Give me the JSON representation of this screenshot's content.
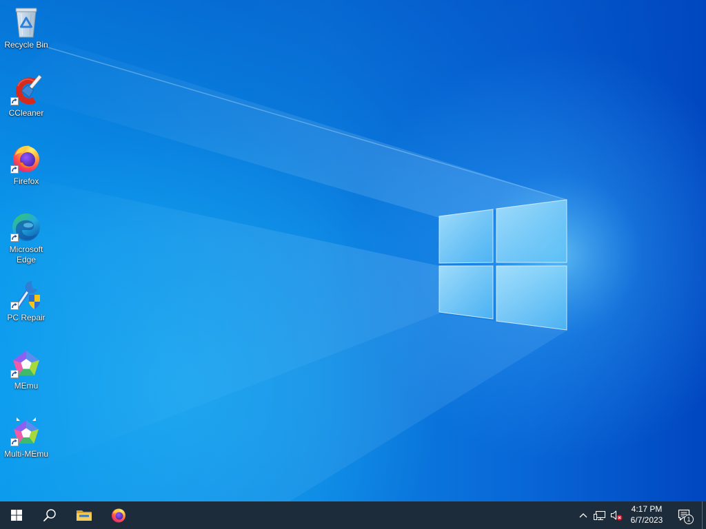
{
  "desktop": {
    "icons": [
      {
        "label": "Recycle Bin",
        "icon": "recycle-bin-icon",
        "shortcut": false
      },
      {
        "label": "CCleaner",
        "icon": "ccleaner-icon",
        "shortcut": true
      },
      {
        "label": "Firefox",
        "icon": "firefox-icon",
        "shortcut": true
      },
      {
        "label": "Microsoft Edge",
        "icon": "edge-icon",
        "shortcut": true
      },
      {
        "label": "PC Repair",
        "icon": "pc-repair-icon",
        "shortcut": true
      },
      {
        "label": "MEmu",
        "icon": "memu-icon",
        "shortcut": true
      },
      {
        "label": "Multi-MEmu",
        "icon": "multi-memu-icon",
        "shortcut": true
      }
    ]
  },
  "taskbar": {
    "buttons": [
      {
        "icon": "windows-start-icon"
      },
      {
        "icon": "search-icon"
      },
      {
        "icon": "file-explorer-icon"
      },
      {
        "icon": "firefox-icon"
      }
    ],
    "tray": {
      "icons": [
        "chevron-up-icon",
        "network-icon",
        "volume-muted-icon"
      ],
      "time": "4:17 PM",
      "date": "6/7/2023",
      "notification_count": "1"
    }
  },
  "colors": {
    "taskbar": "#1d2c3a",
    "wallpaper": "#0b78d8",
    "label_text": "#ffffff",
    "muted_badge": "#e81123"
  }
}
